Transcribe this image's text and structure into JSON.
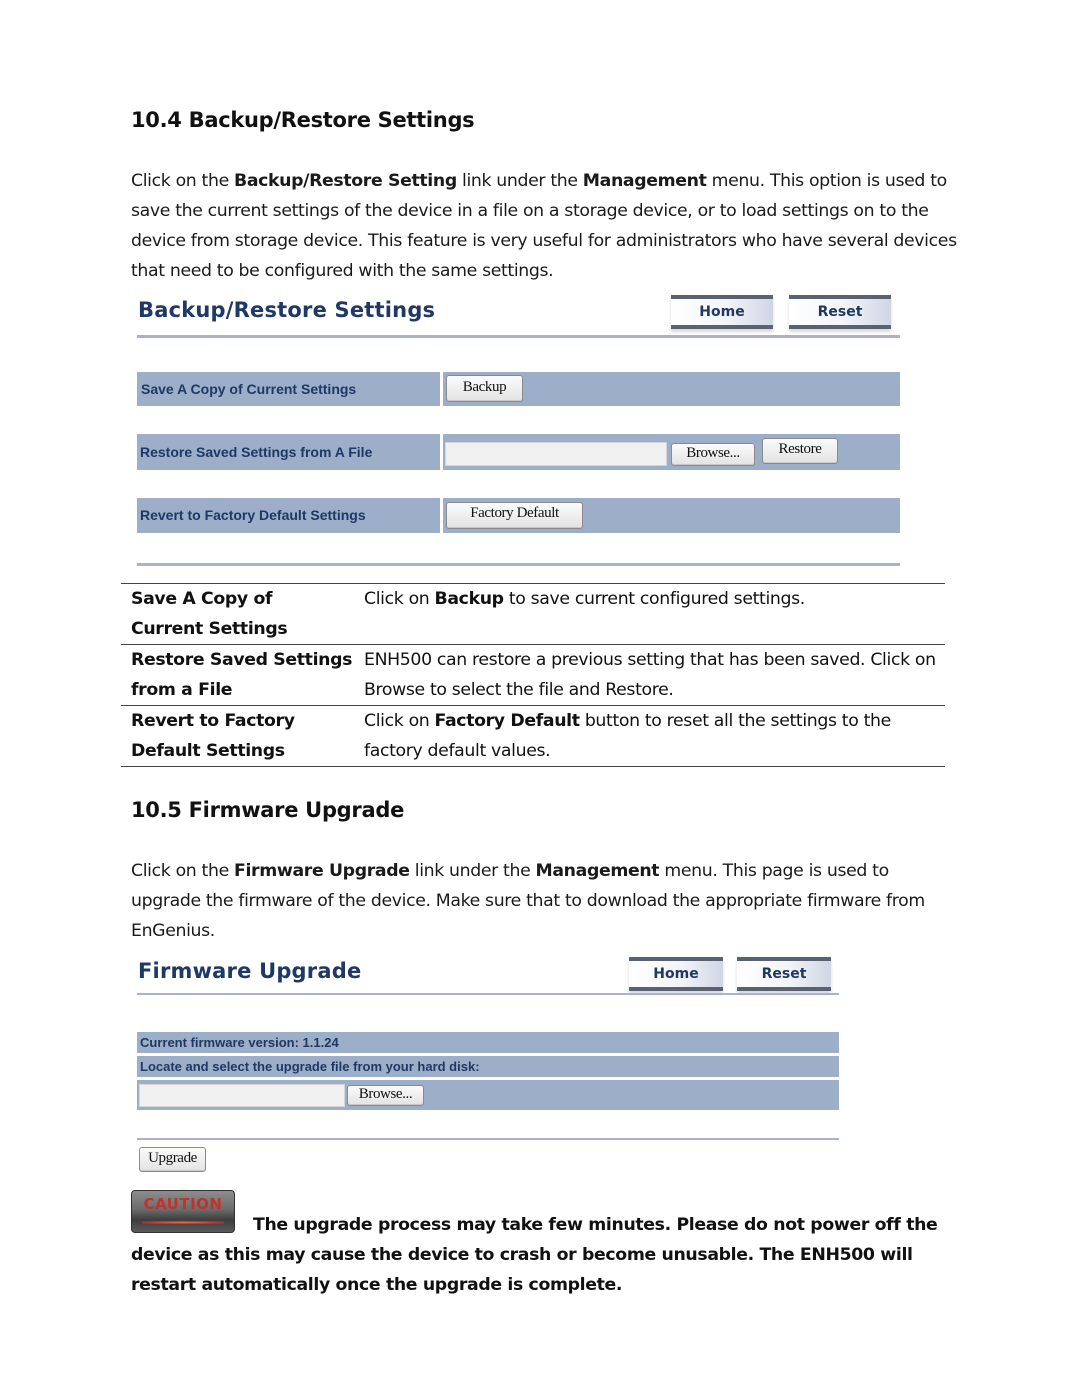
{
  "section_backup": {
    "heading": "10.4 Backup/Restore Settings",
    "intro": {
      "p1": "Click on the ",
      "b1": "Backup/Restore Setting",
      "p2": " link under the ",
      "b2": "Management",
      "p3": " menu. This option is used to save the current settings of the device in a file on a storage device, or to load settings on to the device from storage device. This feature is very useful for administrators who have several devices that need to be configured with the same settings."
    },
    "ui": {
      "title": "Backup/Restore Settings",
      "home_label": "Home",
      "reset_label": "Reset",
      "rows": [
        {
          "label": "Save A Copy of Current Settings",
          "button": "Backup"
        },
        {
          "label": "Restore Saved Settings from A File",
          "file_value": "",
          "browse": "Browse...",
          "button": "Restore"
        },
        {
          "label": "Revert to Factory Default Settings",
          "button": "Factory Default"
        }
      ]
    },
    "table": [
      {
        "key_line1": "Save A Copy of",
        "key_line2": "Current Settings",
        "v_pre": "Click on ",
        "v_bold": "Backup",
        "v_post": " to save current configured settings."
      },
      {
        "key_line1": "Restore Saved Settings",
        "key_line2": "from a File",
        "v_pre": "ENH500 can restore a previous setting that has been saved. Click on Browse to select the file and Restore.",
        "v_bold": "",
        "v_post": ""
      },
      {
        "key_line1": "Revert to Factory",
        "key_line2": "Default Settings",
        "v_pre": "Click on ",
        "v_bold": "Factory Default",
        "v_post": " button to reset all the settings to the factory default values."
      }
    ]
  },
  "section_firmware": {
    "heading": "10.5 Firmware Upgrade",
    "intro": {
      "p1": "Click on the ",
      "b1": "Firmware Upgrade",
      "p2": " link under the ",
      "b2": "Management",
      "p3": " menu. This page is used to upgrade the firmware of the device. Make sure that to download the appropriate firmware from EnGenius."
    },
    "ui": {
      "title": "Firmware Upgrade",
      "home_label": "Home",
      "reset_label": "Reset",
      "version_label": "Current firmware version: ",
      "version_value": "1.1.24",
      "locate_label": "Locate and select the upgrade file from your hard disk:",
      "file_value": "",
      "browse": "Browse...",
      "upgrade": "Upgrade"
    },
    "caution": {
      "badge": "CAUTION",
      "text": "The upgrade process may take few minutes. Please do not power off the device as this may cause the device to crash or become unusable. The ENH500 will restart automatically once the upgrade is complete."
    }
  }
}
